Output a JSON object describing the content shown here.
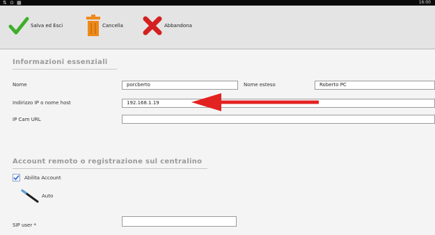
{
  "statusbar": {
    "left_icons": "⇅ ⊙ ▦",
    "time": "16:00"
  },
  "toolbar": {
    "save_label": "Salva ed Esci",
    "delete_label": "Cancella",
    "cancel_label": "Abbandona"
  },
  "section_essential": {
    "title": "Informazioni essenziali",
    "name_label": "Nome",
    "name_value": "porcberto",
    "ext_name_label": "Nome esteso",
    "ext_name_value": "Roberto PC",
    "ip_label": "Indirizzo IP o nome host",
    "ip_value": "192.168.1.19",
    "ipcam_label": "IP Cam URL",
    "ipcam_value": ""
  },
  "section_account": {
    "title": "Account remoto o registrazione sul centralino",
    "enable_label": "Abilita Account",
    "enable_checked": true,
    "auto_label": "Auto",
    "sip_user_label": "SIP user *",
    "sip_user_value": ""
  },
  "colors": {
    "arrow": "#e32222",
    "check_green": "#3fae2a",
    "delete_orange": "#ee8a1a",
    "cancel_red": "#d42020"
  },
  "icons": [
    "check-icon",
    "trash-icon",
    "x-icon",
    "wand-icon",
    "checkbox-icon"
  ]
}
